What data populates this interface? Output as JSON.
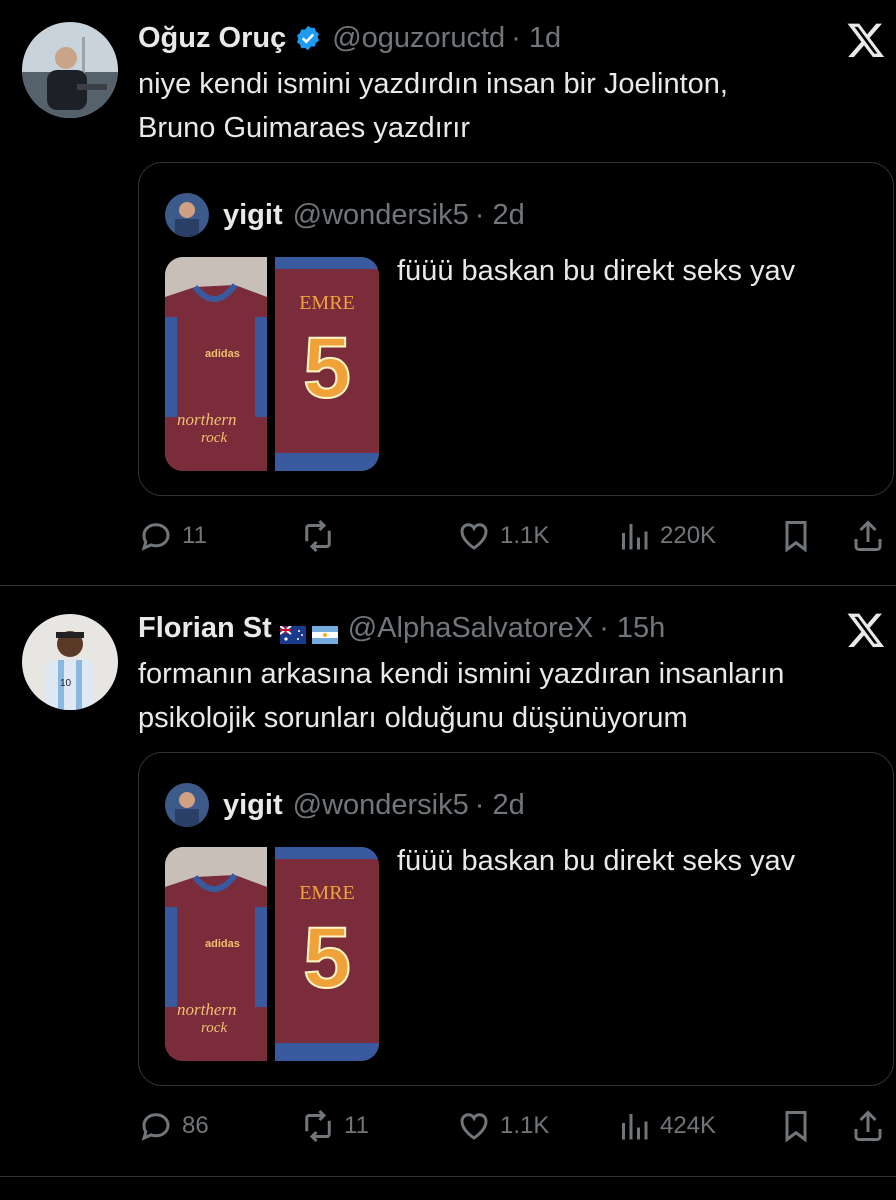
{
  "tweets": [
    {
      "name": "Oğuz Oruç",
      "handle": "@oguzoructd",
      "time": "· 1d",
      "verified": true,
      "text_lines": [
        "niye kendi ismini yazdırdın insan bir Joelinton,",
        "Bruno Guimaraes yazdırır"
      ],
      "quote": {
        "name": "yigit",
        "handle": "@wondersik5",
        "time": "· 2d",
        "text": "füüü baskan bu direkt seks yav",
        "jersey_name": "EMRE",
        "jersey_number": "5",
        "front_brand": "adidas",
        "front_sponsor_1": "northern",
        "front_sponsor_2": "rock"
      },
      "actions": {
        "replies": "11",
        "reposts": "",
        "likes": "1.1K",
        "views": "220K"
      }
    },
    {
      "name": "Florian St",
      "handle": "@AlphaSalvatoreX",
      "time": "· 15h",
      "verified": false,
      "flags": [
        "australia-flag",
        "argentina-flag"
      ],
      "text_lines": [
        "formanın arkasına kendi ismini yazdıran insanların",
        "psikolojik sorunları olduğunu düşünüyorum"
      ],
      "quote": {
        "name": "yigit",
        "handle": "@wondersik5",
        "time": "· 2d",
        "text": "füüü baskan bu direkt seks yav",
        "jersey_name": "EMRE",
        "jersey_number": "5",
        "front_brand": "adidas",
        "front_sponsor_1": "northern",
        "front_sponsor_2": "rock"
      },
      "actions": {
        "replies": "86",
        "reposts": "11",
        "likes": "1.1K",
        "views": "424K"
      }
    }
  ],
  "icons": [
    "reply-icon",
    "repost-icon",
    "like-icon",
    "views-icon",
    "bookmark-icon",
    "share-icon",
    "x-logo-icon",
    "verified-badge-icon"
  ],
  "colors": {
    "background": "#000000",
    "text": "#e7e9ea",
    "muted": "#71767b",
    "border": "#2f3336",
    "verified": "#1d9bf0",
    "jersey": "#7a2c3a",
    "jersey_text": "#f0a23a"
  }
}
